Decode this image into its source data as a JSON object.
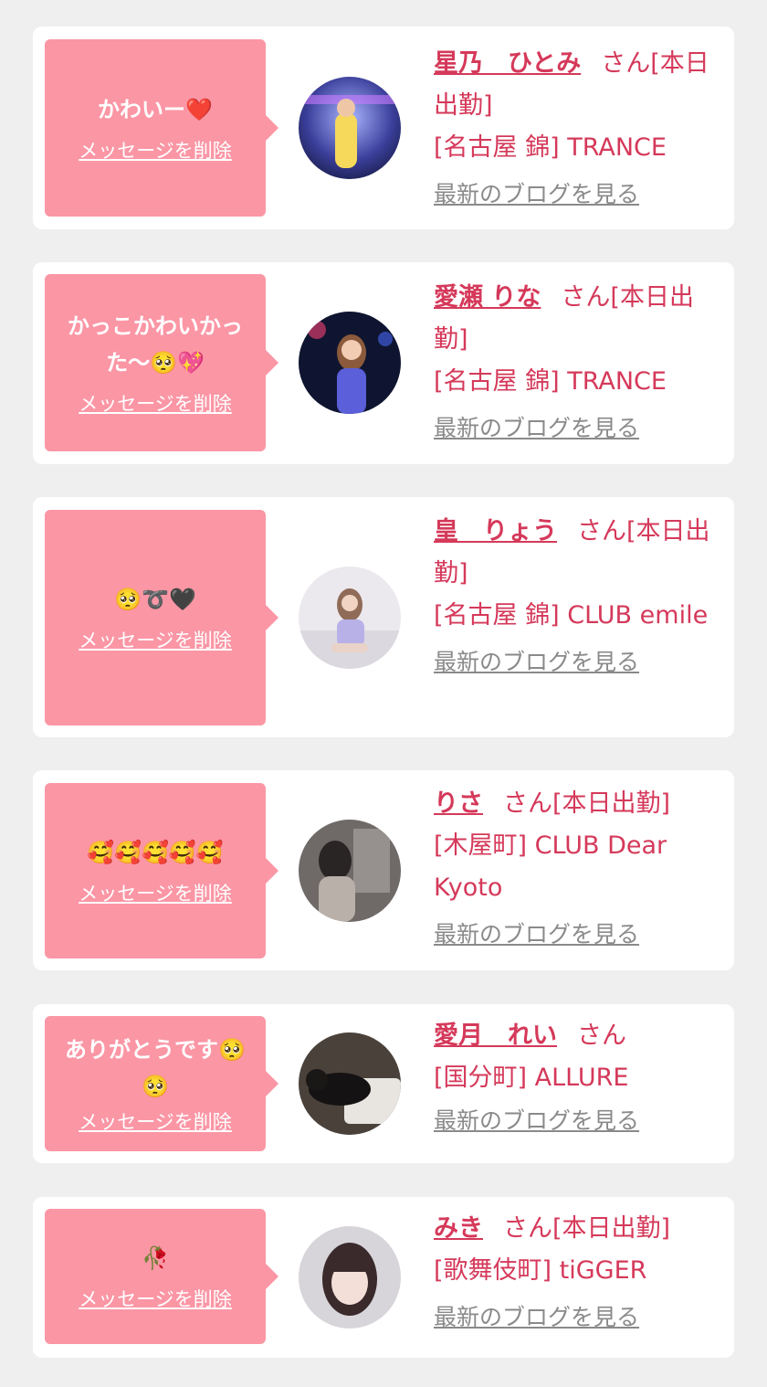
{
  "delete_label": "メッセージを削除",
  "blog_label": "最新のブログを見る",
  "colors": {
    "page_background": "#efefef",
    "card_background": "#ffffff",
    "bubble": "#fb96a5",
    "accent": "#d5395a",
    "link_gray": "#8a8a8a"
  },
  "messages": [
    {
      "message": "かわいー❤️",
      "name": "星乃　ひとみ",
      "suffix": "さん[本日出勤]",
      "shop": "[名古屋 錦] TRANCE"
    },
    {
      "message": "かっこかわいかった〜🥺💖",
      "name": "愛瀬 りな",
      "suffix": "さん[本日出勤]",
      "shop": "[名古屋 錦] TRANCE"
    },
    {
      "message": "🥺➰🖤",
      "name": "皇　りょう",
      "suffix": "さん[本日出勤]",
      "shop": "[名古屋 錦] CLUB emile"
    },
    {
      "message": "🥰🥰🥰🥰🥰",
      "name": "りさ",
      "suffix": "さん[本日出勤]",
      "shop": "[木屋町] CLUB Dear Kyoto"
    },
    {
      "message": "ありがとうです🥺🥺",
      "name": "愛月　れい",
      "suffix": "さん",
      "shop": "[国分町] ALLURE"
    },
    {
      "message": "🥀",
      "name": "みき",
      "suffix": "さん[本日出勤]",
      "shop": "[歌舞伎町] tiGGER"
    }
  ]
}
